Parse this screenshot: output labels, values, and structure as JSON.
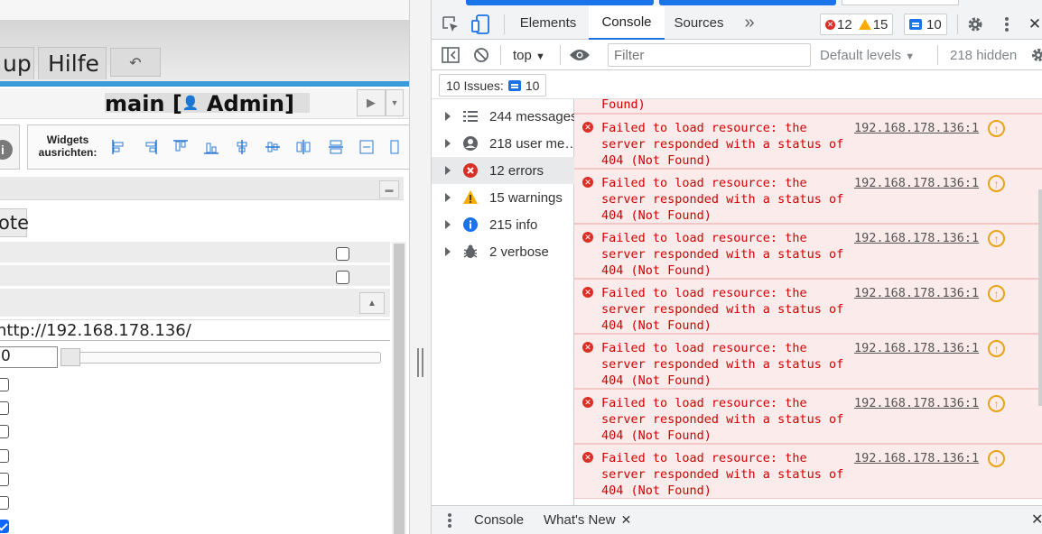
{
  "app": {
    "menu": {
      "item_partial": "up",
      "help_label": "Hilfe",
      "back_symbol": "↶"
    },
    "title": {
      "prefix": "main [",
      "user_symbol": "👤",
      "suffix": " Admin]"
    },
    "title_controls": {
      "play_symbol": "▶",
      "dropdown_symbol": "▼"
    },
    "align": {
      "label": "Widgets ausrichten:",
      "info_symbol": "i"
    },
    "section_toggle_symbol": "▬",
    "tab_partial": "ote",
    "collapse_symbol": "▲",
    "url_value": "http://192.168.178.136/",
    "number_value": "0",
    "checkboxes_bottom": [
      false,
      false,
      false,
      false,
      false,
      false,
      true
    ],
    "checkboxes_top": [
      false,
      false
    ]
  },
  "devtools": {
    "tabs": [
      {
        "label": "Elements"
      },
      {
        "label": "Console",
        "active": true
      },
      {
        "label": "Sources"
      }
    ],
    "more_tabs_symbol": "»",
    "counts": {
      "errors": "12",
      "warnings": "15",
      "messages": "10"
    },
    "toolbar": {
      "context": "top",
      "filter_placeholder": "Filter",
      "levels": "Default levels",
      "hidden": "218 hidden"
    },
    "issues_label": "10 Issues:",
    "issues_count": "10",
    "sidebar": [
      {
        "label": "244 messages",
        "icon": "list-icon"
      },
      {
        "label": "218 user me…",
        "icon": "user-icon"
      },
      {
        "label": "12 errors",
        "icon": "error-icon",
        "selected": true
      },
      {
        "label": "15 warnings",
        "icon": "warning-icon"
      },
      {
        "label": "215 info",
        "icon": "info-icon"
      },
      {
        "label": "2 verbose",
        "icon": "bug-icon"
      }
    ],
    "log_partial_top": "Found)",
    "log": [
      {
        "message": "Failed to load resource: the\nserver responded with a status of\n404 (Not Found)",
        "source": "192.168.178.136:1"
      },
      {
        "message": "Failed to load resource: the\nserver responded with a status of\n404 (Not Found)",
        "source": "192.168.178.136:1"
      },
      {
        "message": "Failed to load resource: the\nserver responded with a status of\n404 (Not Found)",
        "source": "192.168.178.136:1"
      },
      {
        "message": "Failed to load resource: the\nserver responded with a status of\n404 (Not Found)",
        "source": "192.168.178.136:1"
      },
      {
        "message": "Failed to load resource: the\nserver responded with a status of\n404 (Not Found)",
        "source": "192.168.178.136:1"
      },
      {
        "message": "Failed to load resource: the\nserver responded with a status of\n404 (Not Found)",
        "source": "192.168.178.136:1"
      },
      {
        "message": "Failed to load resource: the\nserver responded with a status of\n404 (Not Found)",
        "source": "192.168.178.136:1"
      }
    ],
    "drawer": {
      "console_label": "Console",
      "whatsnew_label": "What's New",
      "close_symbol": "✕"
    },
    "colors": {
      "accent": "#1a73e8",
      "error": "#d93025",
      "warning": "#f9ab00",
      "error_bg": "#fcebeb"
    }
  }
}
